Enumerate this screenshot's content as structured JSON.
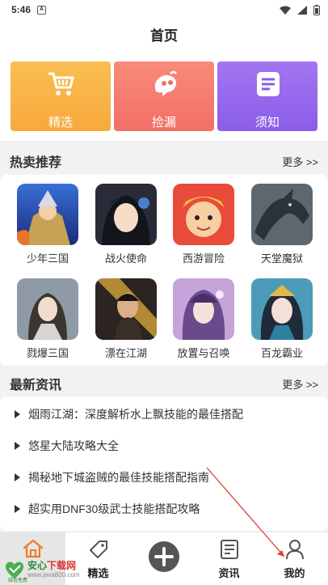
{
  "status_bar": {
    "time": "5:46",
    "notif_letter": "A"
  },
  "header": {
    "title": "首页"
  },
  "shortcuts": [
    {
      "label": "精选",
      "icon": "cart-icon"
    },
    {
      "label": "捡漏",
      "icon": "mascot-icon"
    },
    {
      "label": "须知",
      "icon": "notice-icon"
    }
  ],
  "hot": {
    "title": "热卖推荐",
    "more": "更多 >>",
    "games": [
      {
        "name": "少年三国"
      },
      {
        "name": "战火使命"
      },
      {
        "name": "西游冒险"
      },
      {
        "name": "天堂魔狱"
      },
      {
        "name": "戮爆三国"
      },
      {
        "name": "漂在江湖"
      },
      {
        "name": "放置与召唤"
      },
      {
        "name": "百龙霸业"
      }
    ]
  },
  "news": {
    "title": "最新资讯",
    "more": "更多 >>",
    "items": [
      {
        "text": "烟雨江湖：深度解析水上飘技能的最佳搭配"
      },
      {
        "text": "悠星大陆攻略大全"
      },
      {
        "text": "揭秘地下城盗贼的最佳技能搭配指南"
      },
      {
        "text": "超实用DNF30级武士技能搭配攻略"
      }
    ]
  },
  "tabbar": {
    "home": "",
    "featured": "精选",
    "news": "资讯",
    "mine": "我的"
  },
  "watermark": {
    "main_a": "安心",
    "main_b": "下载网",
    "url": "www.java800.com",
    "sub": "绿色免费"
  },
  "colors": {
    "accent_orange": "#f47a22",
    "tile_yellow": "#f7a93c",
    "tile_red": "#f26f66",
    "tile_purple": "#8a5de8"
  }
}
